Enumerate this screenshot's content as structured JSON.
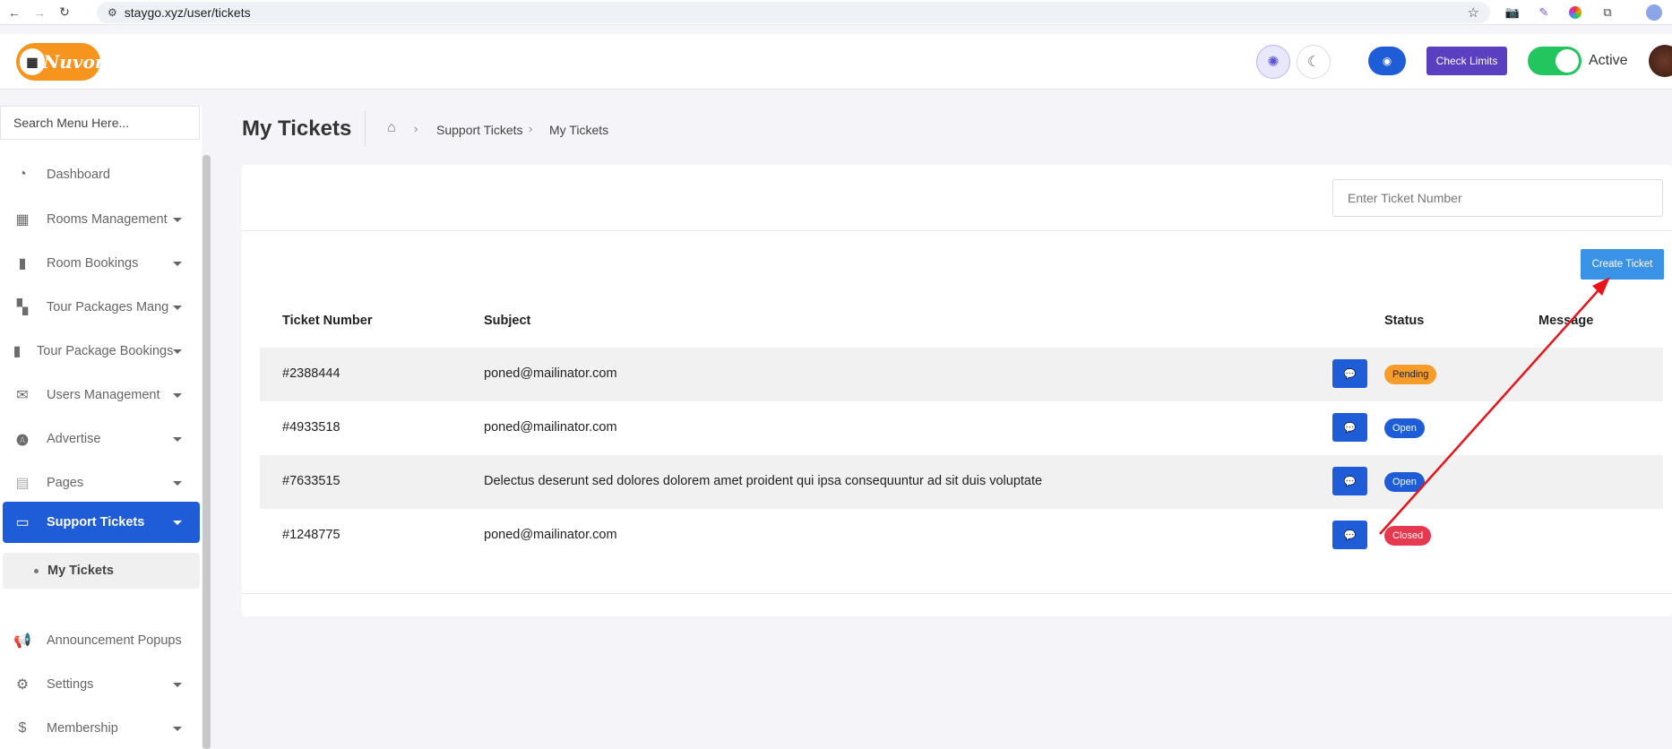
{
  "browser": {
    "url": "staygo.xyz/user/tickets",
    "back_icon": "←",
    "forward_icon": "→",
    "reload_icon": "↻",
    "star_icon": "☆"
  },
  "header": {
    "logo_text": "Nuvora",
    "check_limits_label": "Check Limits",
    "status_label": "Active",
    "toggle_on": true
  },
  "sidebar": {
    "search_placeholder": "Search Menu Here...",
    "items": [
      {
        "label": "Dashboard",
        "icon": "gauge-icon"
      },
      {
        "label": "Rooms Management",
        "icon": "building-icon"
      },
      {
        "label": "Room Bookings",
        "icon": "bookmark-icon"
      },
      {
        "label": "Tour Packages Mang",
        "icon": "boxes-icon"
      },
      {
        "label": "Tour Package Bookings",
        "icon": "bookmark-icon"
      },
      {
        "label": "Users Management",
        "icon": "inbox-user-icon"
      },
      {
        "label": "Advertise",
        "icon": "ad-icon"
      },
      {
        "label": "Pages",
        "icon": "file-icon"
      },
      {
        "label": "Support Tickets",
        "icon": "ticket-icon"
      },
      {
        "label": "Announcement Popups",
        "icon": "megaphone-icon"
      },
      {
        "label": "Settings",
        "icon": "gear-icon"
      },
      {
        "label": "Membership",
        "icon": "dollar-file-icon"
      }
    ],
    "sub_item": "My Tickets"
  },
  "page": {
    "title": "My Tickets",
    "breadcrumb": [
      "Support Tickets",
      "My Tickets"
    ]
  },
  "tickets": {
    "search_placeholder": "Enter Ticket Number",
    "create_label": "Create Ticket",
    "columns": [
      "Ticket Number",
      "Subject",
      "Status",
      "Message"
    ],
    "rows": [
      {
        "number": "#2388444",
        "subject": "poned@mailinator.com",
        "status": "Pending"
      },
      {
        "number": "#4933518",
        "subject": "poned@mailinator.com",
        "status": "Open"
      },
      {
        "number": "#7633515",
        "subject": "Delectus deserunt sed dolores dolorem amet proident qui ipsa consequuntur ad sit duis voluptate",
        "status": "Open"
      },
      {
        "number": "#1248775",
        "subject": "poned@mailinator.com",
        "status": "Closed"
      }
    ]
  },
  "colors": {
    "primary": "#1e5cd8",
    "pending": "#f59c2a",
    "closed": "#e63950",
    "annotation_arrow": "#e8141c"
  }
}
